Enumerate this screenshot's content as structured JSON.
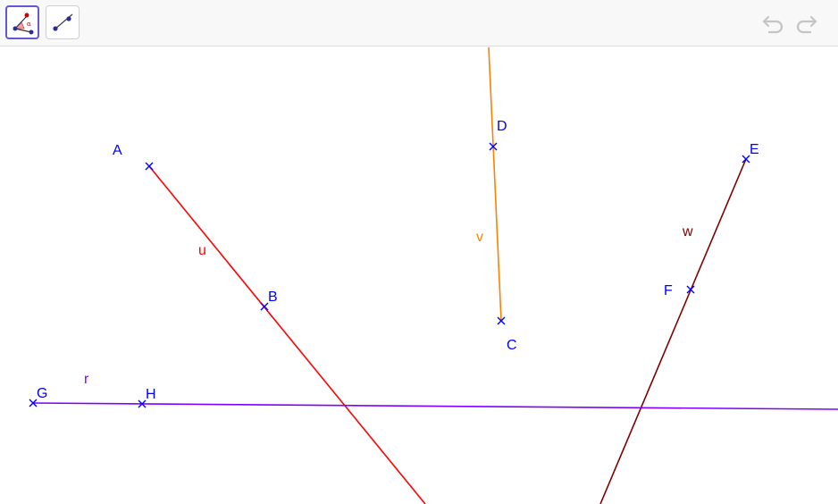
{
  "toolbar": {
    "tools": [
      {
        "name": "Angle / move graphics",
        "selected": true,
        "icon": "angle-tool-icon",
        "alpha_glyph": "α"
      },
      {
        "name": "Segment",
        "selected": false,
        "icon": "segment-tool-icon"
      }
    ],
    "undo_icon": "undo-icon",
    "redo_icon": "redo-icon"
  },
  "construction": {
    "points": {
      "A": "A",
      "B": "B",
      "C": "C",
      "D": "D",
      "E": "E",
      "F": "F",
      "G": "G",
      "H": "H"
    },
    "objects": {
      "u": "u",
      "v": "v",
      "w": "w",
      "r": "r"
    },
    "colors": {
      "u": "#ff0000",
      "v": "#ff8000",
      "w": "#800000",
      "r": "#8000ff",
      "point": "#0000ff",
      "toolbar_accent": "#6557d2"
    }
  }
}
